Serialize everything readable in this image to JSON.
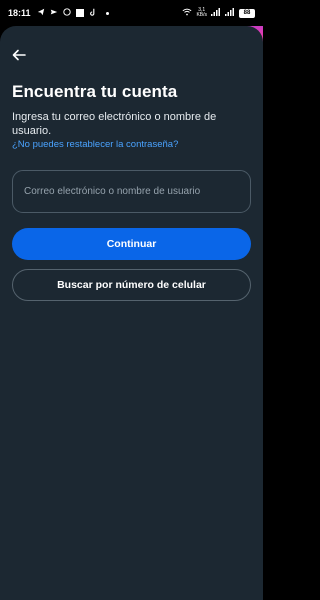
{
  "status_bar": {
    "time": "18:11",
    "icons": [
      "telegram-icon",
      "send-icon",
      "whatsapp-icon",
      "square-icon",
      "tiktok-icon",
      "dot-icon"
    ],
    "net_speed_top": "3,1",
    "net_speed_bottom": "KB/s",
    "battery": "88"
  },
  "header": {
    "back_icon": "arrow-left-icon"
  },
  "main": {
    "title": "Encuentra tu cuenta",
    "subtitle": "Ingresa tu correo electrónico o nombre de usuario.",
    "link": "¿No puedes restablecer la contraseña?",
    "input_placeholder": "Correo electrónico o nombre de usuario",
    "input_value": "",
    "primary_button": "Continuar",
    "secondary_button": "Buscar por número de celular"
  },
  "colors": {
    "background": "#1c2832",
    "primary": "#0a66e8",
    "link": "#4aa3ff"
  }
}
